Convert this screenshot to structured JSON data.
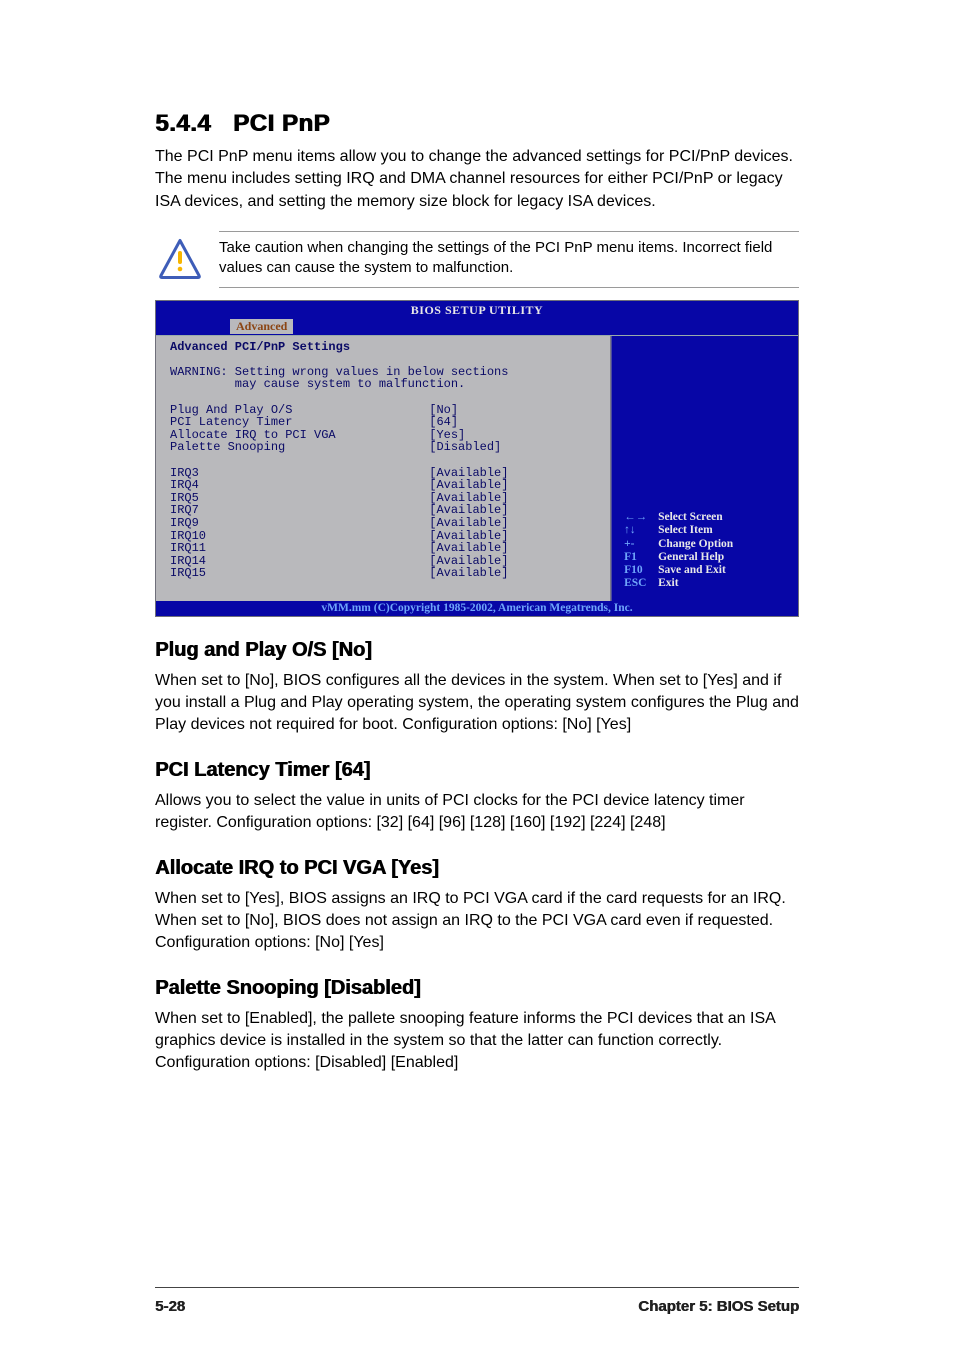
{
  "section": {
    "number": "5.4.4",
    "name": "PCI PnP",
    "intro": "The PCI PnP menu items allow you to change the advanced settings for PCI/PnP devices. The menu includes setting IRQ and DMA channel resources for either PCI/PnP or legacy ISA devices, and setting the memory size block for legacy ISA devices."
  },
  "caution": "Take caution when changing the settings of the PCI PnP menu items. Incorrect field values can cause the system to malfunction.",
  "bios": {
    "title": "BIOS SETUP UTILITY",
    "tab": "Advanced",
    "left_heading": "Advanced PCI/PnP Settings",
    "warning_label": "WARNING:",
    "warning_l1": "Setting wrong values in below sections",
    "warning_l2": "may cause system to malfunction.",
    "settings": [
      {
        "label": "Plug And Play O/S",
        "value": "[No]"
      },
      {
        "label": "PCI Latency Timer",
        "value": "[64]"
      },
      {
        "label": "Allocate IRQ to PCI VGA",
        "value": "[Yes]"
      },
      {
        "label": "Palette Snooping",
        "value": "[Disabled]"
      }
    ],
    "irqs": [
      {
        "label": "IRQ3",
        "value": "[Available]"
      },
      {
        "label": "IRQ4",
        "value": "[Available]"
      },
      {
        "label": "IRQ5",
        "value": "[Available]"
      },
      {
        "label": "IRQ7",
        "value": "[Available]"
      },
      {
        "label": "IRQ9",
        "value": "[Available]"
      },
      {
        "label": "IRQ10",
        "value": "[Available]"
      },
      {
        "label": "IRQ11",
        "value": "[Available]"
      },
      {
        "label": "IRQ14",
        "value": "[Available]"
      },
      {
        "label": "IRQ15",
        "value": "[Available]"
      }
    ],
    "nav": [
      {
        "key": "←→",
        "label": "Select Screen"
      },
      {
        "key": "↑↓",
        "label": "Select Item"
      },
      {
        "key": "+-",
        "label": "Change Option"
      },
      {
        "key": "F1",
        "label": "General Help"
      },
      {
        "key": "F10",
        "label": "Save and Exit"
      },
      {
        "key": "ESC",
        "label": "Exit"
      }
    ],
    "copyright": "vMM.mm (C)Copyright 1985-2002, American Megatrends, Inc."
  },
  "subsections": [
    {
      "heading": "Plug and Play O/S [No]",
      "body": "When set to [No], BIOS configures all the devices in the system. When set to [Yes] and if you install a Plug and Play operating system, the operating system configures the Plug and Play devices not required for boot. Configuration options: [No] [Yes]"
    },
    {
      "heading": "PCI Latency Timer [64]",
      "body": "Allows you to select the value in units of PCI clocks for the PCI device latency timer register. Configuration options: [32] [64] [96] [128] [160] [192] [224] [248]"
    },
    {
      "heading": "Allocate IRQ to PCI VGA [Yes]",
      "body": "When set to [Yes], BIOS assigns an IRQ to PCI VGA card if the card requests for an IRQ. When set to [No], BIOS does not assign an IRQ to the PCI VGA card even if requested. Configuration options: [No] [Yes]"
    },
    {
      "heading": "Palette Snooping [Disabled]",
      "body": "When set to [Enabled], the pallete snooping feature informs the PCI devices that an ISA graphics device is installed in the system so that the latter can function correctly. Configuration options: [Disabled] [Enabled]"
    }
  ],
  "footer": {
    "page": "5-28",
    "chapter": "Chapter 5: BIOS Setup"
  }
}
